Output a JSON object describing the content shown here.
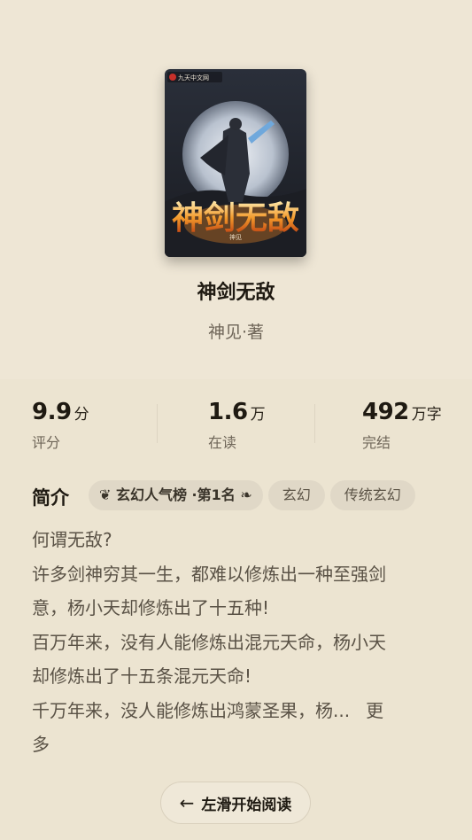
{
  "book": {
    "title": "神剑无敌",
    "author": "神见·著",
    "cover": {
      "publisher_mark": "九天中文网",
      "cover_title": "神剑无敌",
      "cover_author": "神见"
    }
  },
  "stats": [
    {
      "value": "9.9",
      "unit": "分",
      "label": "评分"
    },
    {
      "value": "1.6",
      "unit": "万",
      "label": "在读"
    },
    {
      "value": "492",
      "unit": "万字",
      "label": "完结"
    }
  ],
  "intro": {
    "heading": "简介",
    "tags": [
      {
        "text": "玄幻人气榜 ·第1名",
        "laurel_left": "❦",
        "laurel_right": "❧"
      },
      {
        "text": "玄幻"
      },
      {
        "text": "传统玄幻"
      }
    ],
    "lines": [
      "何谓无敌?",
      "许多剑神穷其一生，都难以修炼出一种至强剑",
      "意，杨小天却修炼出了十五种!",
      "百万年来，没有人能修炼出混元天命，杨小天",
      "却修炼出了十五条混元天命!",
      "千万年来，没人能修炼出鸿蒙圣果，杨...",
      "多"
    ],
    "more_label": "更"
  },
  "actions": {
    "read_label": "左滑开始阅读",
    "read_icon": "arrow-left-icon"
  },
  "colors": {
    "background": "#ece4d1",
    "top_background": "#eee6d5",
    "tag_background": "#e0d8c7",
    "text_primary": "#1f1a12",
    "text_secondary": "#6f6659"
  }
}
